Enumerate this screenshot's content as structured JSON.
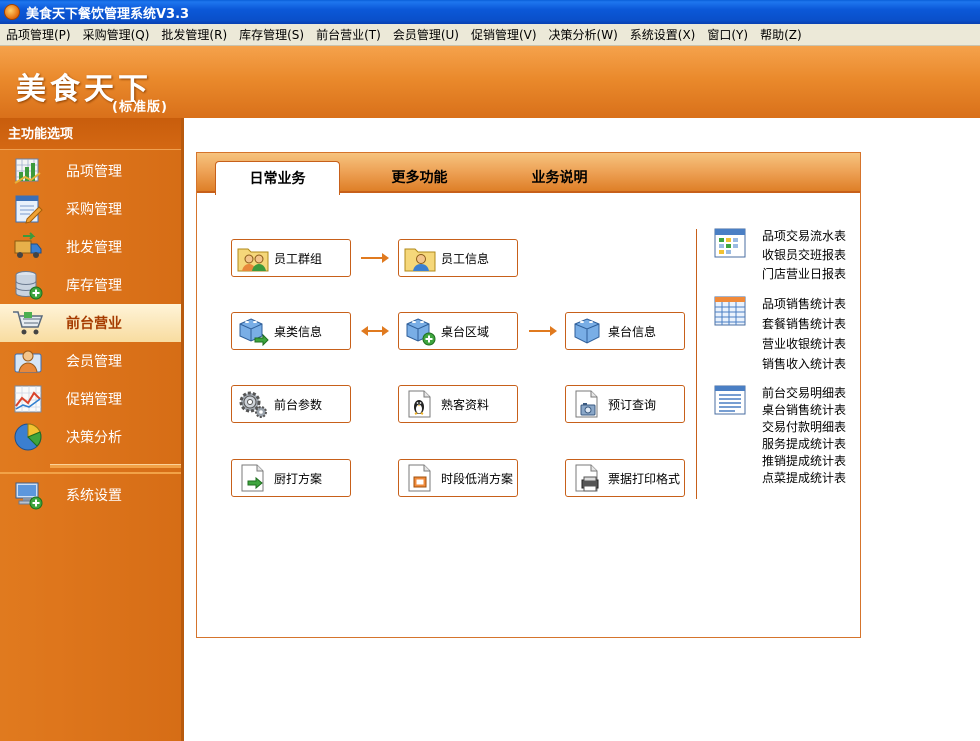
{
  "window": {
    "title": "美食天下餐饮管理系统V3.3"
  },
  "menu": [
    "品项管理(P)",
    "采购管理(Q)",
    "批发管理(R)",
    "库存管理(S)",
    "前台营业(T)",
    "会员管理(U)",
    "促销管理(V)",
    "决策分析(W)",
    "系统设置(X)",
    "窗口(Y)",
    "帮助(Z)"
  ],
  "banner": {
    "logo": "美食天下",
    "edition": "(标准版)"
  },
  "sidebar": {
    "heading": "主功能选项",
    "items": [
      {
        "label": "品项管理",
        "icon": "chart-bars-icon"
      },
      {
        "label": "采购管理",
        "icon": "document-edit-icon"
      },
      {
        "label": "批发管理",
        "icon": "truck-icon"
      },
      {
        "label": "库存管理",
        "icon": "database-add-icon"
      },
      {
        "label": "前台营业",
        "icon": "cart-icon",
        "active": true
      },
      {
        "label": "会员管理",
        "icon": "member-card-icon"
      },
      {
        "label": "促销管理",
        "icon": "line-chart-icon"
      },
      {
        "label": "决策分析",
        "icon": "pie-chart-icon"
      },
      {
        "label": "系统设置",
        "icon": "computer-add-icon"
      }
    ]
  },
  "tabs": [
    {
      "label": "日常业务",
      "active": true
    },
    {
      "label": "更多功能"
    },
    {
      "label": "业务说明"
    }
  ],
  "functions": {
    "employee_group": "员工群组",
    "employee_info": "员工信息",
    "table_type": "桌类信息",
    "table_area": "桌台区域",
    "table_info": "桌台信息",
    "frontdesk_params": "前台参数",
    "regular_customer": "熟客资料",
    "reservation_query": "预订查询",
    "kitchen_print": "厨打方案",
    "time_min_spend": "时段低消方案",
    "receipt_format": "票据打印格式"
  },
  "reports": {
    "group1": [
      "品项交易流水表",
      "收银员交班报表",
      "门店营业日报表"
    ],
    "group2": [
      "品项销售统计表",
      "套餐销售统计表",
      "营业收银统计表",
      "销售收入统计表"
    ],
    "group3": [
      "前台交易明细表",
      "桌台销售统计表",
      "交易付款明细表",
      "服务提成统计表",
      "推销提成统计表",
      "点菜提成统计表"
    ]
  },
  "colors": {
    "accent": "#e07a1f",
    "tab_border": "#c7601a",
    "titlebar": "#0a4fc9"
  }
}
